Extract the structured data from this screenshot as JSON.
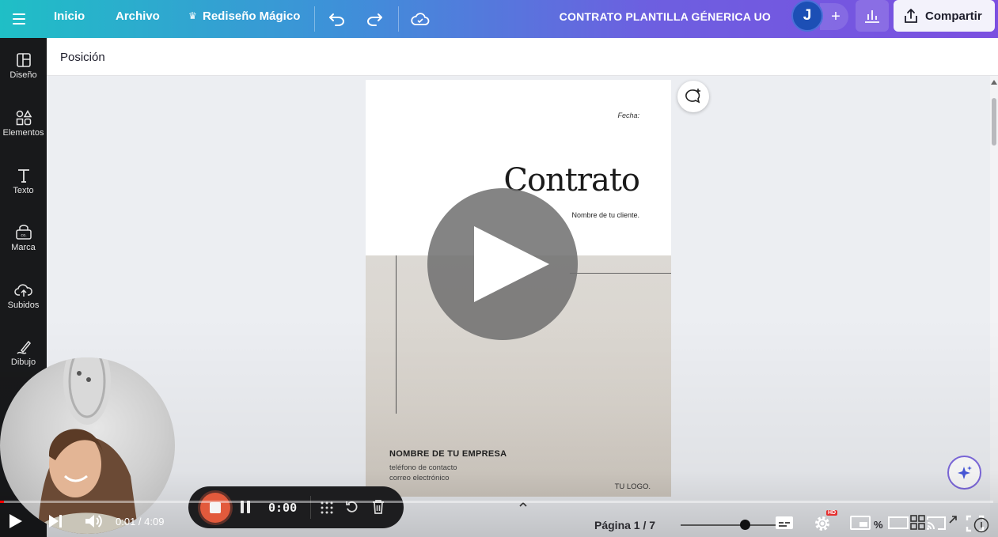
{
  "topbar": {
    "inicio": "Inicio",
    "archivo": "Archivo",
    "redesign": "Rediseño Mágico",
    "title": "CONTRATO PLANTILLA GÉNERICA UO",
    "avatar": "J",
    "plus": "+",
    "share": "Compartir"
  },
  "sidebar": {
    "items": [
      {
        "label": "Diseño",
        "icon": "layout-icon"
      },
      {
        "label": "Elementos",
        "icon": "shapes-icon"
      },
      {
        "label": "Texto",
        "icon": "text-icon"
      },
      {
        "label": "Marca",
        "icon": "brand-icon"
      },
      {
        "label": "Subidos",
        "icon": "upload-icon"
      },
      {
        "label": "Dibujo",
        "icon": "draw-icon"
      }
    ]
  },
  "subheader": {
    "label": "Posición"
  },
  "page": {
    "fecha": "Fecha:",
    "title": "Contrato",
    "client": "Nombre de tu cliente.",
    "company": "NOMBRE DE TU EMPRESA",
    "phone": "teléfono de contacto",
    "email": "correo electrónico",
    "logo": "TU LOGO."
  },
  "recorder": {
    "time": "0:00"
  },
  "video": {
    "current": "0:01",
    "separator": " / ",
    "duration": "4:09",
    "progress": 0.004
  },
  "footer": {
    "pagina": "Página 1 / 7",
    "zoom": "% ",
    "hd": "HD"
  },
  "colors": {
    "accent": "#7b4fe0",
    "teal": "#1fbfc6",
    "record": "#e25a3c",
    "progress": "#ff0000"
  }
}
